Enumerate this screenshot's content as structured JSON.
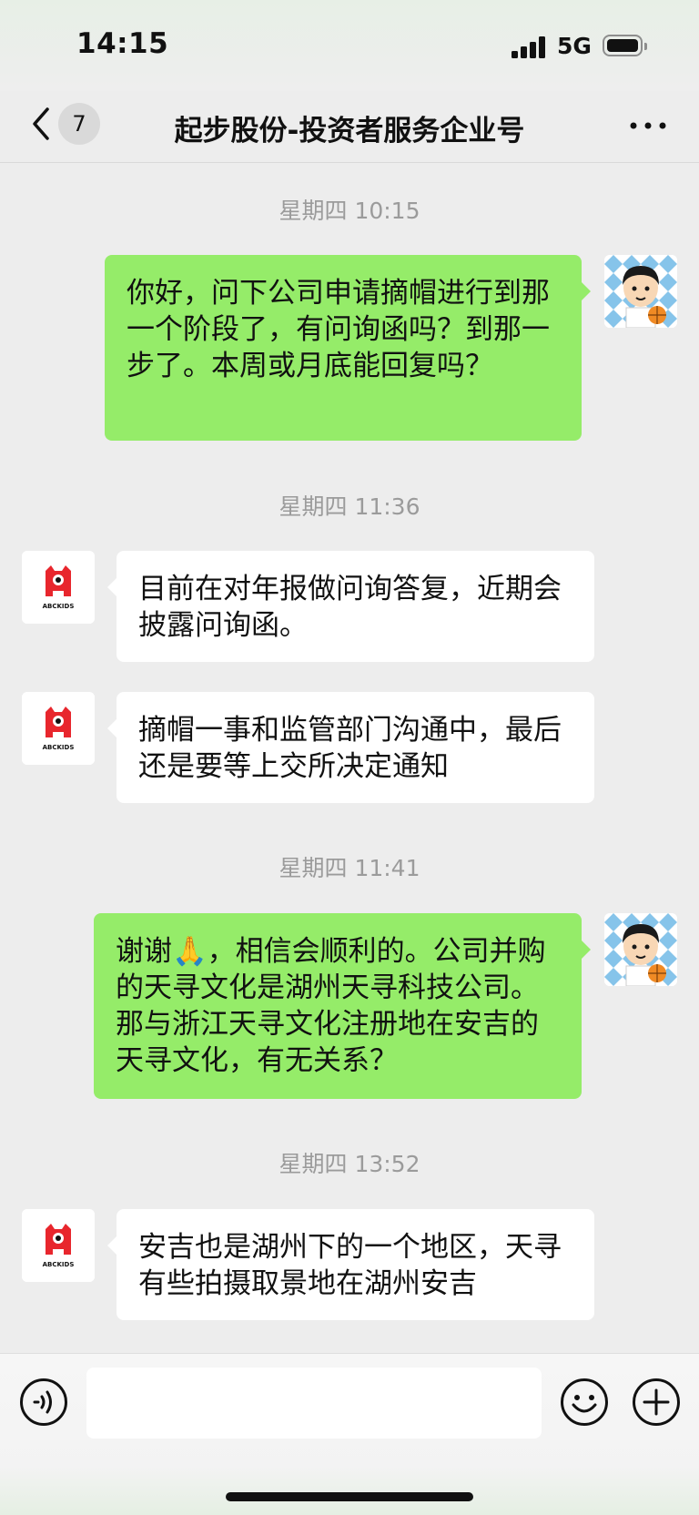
{
  "status_bar": {
    "time": "14:15",
    "network": "5G"
  },
  "header": {
    "unread_badge": "7",
    "title": "起步股份-投资者服务企业号"
  },
  "messages": [
    {
      "timestamp": "星期四 10:15"
    },
    {
      "sender": "me",
      "text": "你好，问下公司申请摘帽进行到那一个阶段了，有问询函吗？到那一步了。本周或月底能回复吗？"
    },
    {
      "timestamp": "星期四 11:36"
    },
    {
      "sender": "them",
      "text": "目前在对年报做问询答复，近期会披露问询函。"
    },
    {
      "sender": "them",
      "text": "摘帽一事和监管部门沟通中，最后还是要等上交所决定通知"
    },
    {
      "timestamp": "星期四 11:41"
    },
    {
      "sender": "me",
      "text": "谢谢🙏，相信会顺利的。公司并购的天寻文化是湖州天寻科技公司。那与浙江天寻文化注册地在安吉的天寻文化，有无关系？"
    },
    {
      "timestamp": "星期四 13:52"
    },
    {
      "sender": "them",
      "text": "安吉也是湖州下的一个地区，天寻有些拍摄取景地在湖州安吉"
    }
  ],
  "company_avatar_text": "ABCKIDS",
  "colors": {
    "my_bubble": "#95ec69",
    "their_bubble": "#ffffff",
    "background": "#ededed",
    "brand_red": "#e8262d"
  },
  "icons": {
    "back": "chevron-left-icon",
    "more": "more-dots-icon",
    "voice": "voice-icon",
    "emoji": "emoji-icon",
    "add": "plus-circle-icon"
  }
}
